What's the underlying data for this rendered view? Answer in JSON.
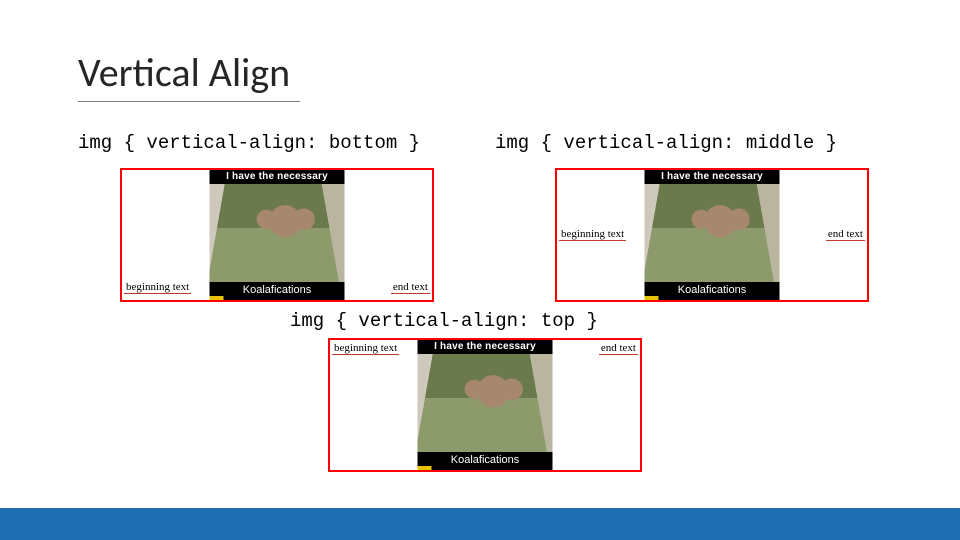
{
  "title": "Vertical Align",
  "examples": {
    "bottom": {
      "code": "img { vertical-align: bottom }"
    },
    "middle": {
      "code": "img { vertical-align: middle }"
    },
    "top": {
      "code": "img { vertical-align: top }"
    }
  },
  "demo_labels": {
    "begin": "beginning text",
    "end": "end text"
  },
  "meme": {
    "top": "I have the necessary",
    "bottom": "Koalafications"
  }
}
